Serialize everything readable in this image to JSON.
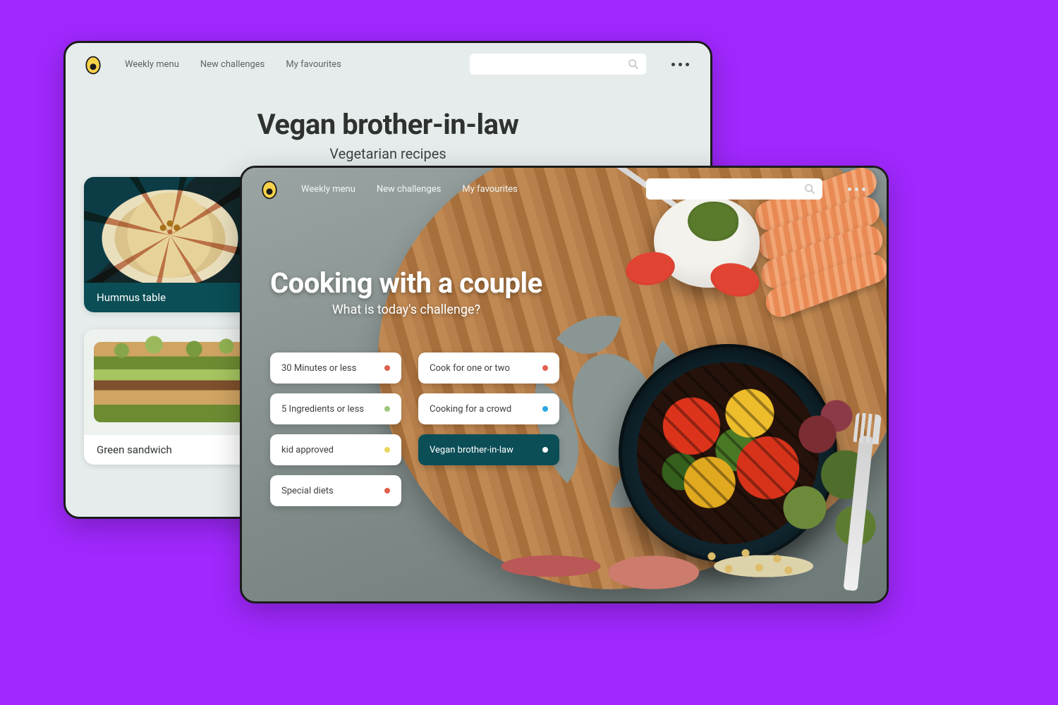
{
  "nav": {
    "items": [
      "Weekly menu",
      "New challenges",
      "My favourites"
    ]
  },
  "back": {
    "title": "Vegan brother-in-law",
    "subtitle": "Vegetarian recipes",
    "cards": [
      {
        "caption": "Hummus table",
        "dark": true
      },
      {
        "caption": "Green sandwich",
        "dark": false
      }
    ]
  },
  "front": {
    "title": "Cooking with a couple",
    "subtitle": "What is today's challenge?",
    "chips": [
      {
        "label": "30 Minutes or less",
        "dot": "#e0604f",
        "col": 0
      },
      {
        "label": "Cook for one or two",
        "dot": "#e0604f",
        "col": 1
      },
      {
        "label": "5 Ingredients or less",
        "dot": "#9ec77a",
        "col": 0
      },
      {
        "label": "Cooking for a crowd",
        "dot": "#2aa7e0",
        "col": 1
      },
      {
        "label": "kid approved",
        "dot": "#e9d65b",
        "col": 0
      },
      {
        "label": "Vegan brother-in-law",
        "dot": "#ffffff",
        "col": 1,
        "active": true
      },
      {
        "label": "Special diets",
        "dot": "#e0604f",
        "col": 0
      }
    ]
  },
  "colors": {
    "page_bg": "#a128ff",
    "teal_dark": "#0b4e56"
  }
}
